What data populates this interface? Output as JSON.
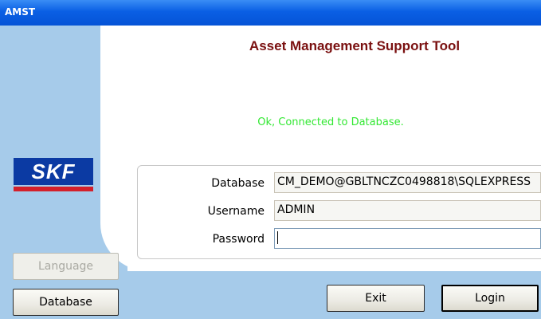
{
  "window": {
    "title": "AMST"
  },
  "header": {
    "app_title": "Asset Management Support Tool"
  },
  "status": {
    "message": "Ok, Connected to Database."
  },
  "logo": {
    "text": "SKF"
  },
  "form": {
    "database_label": "Database",
    "database_value": "CM_DEMO@GBLTNCZC0498818\\SQLEXPRESS",
    "username_label": "Username",
    "username_value": "ADMIN",
    "password_label": "Password",
    "password_value": ""
  },
  "buttons": {
    "language": "Language",
    "database": "Database",
    "exit": "Exit",
    "login": "Login"
  },
  "colors": {
    "titlebar": "#0553d6",
    "sidebar": "#a6cbea",
    "app_title": "#7a1010",
    "status_ok": "#33e833",
    "logo_blue": "#0b3aa3",
    "logo_red": "#d3202b"
  }
}
